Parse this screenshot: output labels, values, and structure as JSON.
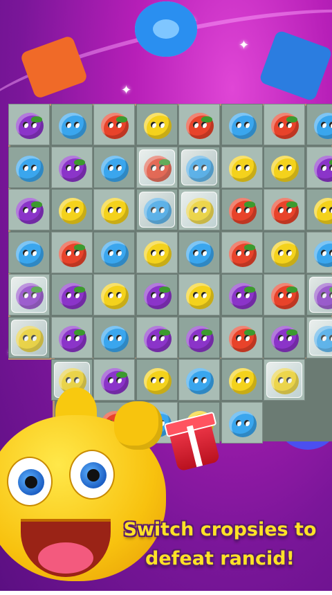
{
  "caption": {
    "line1": "Switch cropsies to",
    "line2": "defeat rancid!"
  },
  "colors": {
    "purple": "#8b34c9",
    "blue": "#3aa6ee",
    "red": "#e8432a",
    "yellow": "#f4d21c",
    "caption_text": "#ffe227"
  },
  "board": {
    "rows": [
      [
        "purple",
        "blue",
        "red",
        "yellow",
        "red",
        "blue",
        "red",
        "blue"
      ],
      [
        "blue",
        "purple",
        "blue",
        "red*",
        "blue*",
        "yellow",
        "yellow",
        "purple"
      ],
      [
        "purple",
        "yellow",
        "yellow",
        "blue*",
        "yellow*",
        "red",
        "red",
        "yellow"
      ],
      [
        "blue",
        "red",
        "blue",
        "yellow",
        "blue",
        "red",
        "yellow",
        "blue"
      ],
      [
        "purple*",
        "purple",
        "yellow",
        "purple",
        "yellow",
        "purple",
        "red",
        "purple*"
      ],
      [
        "yellow*",
        "purple",
        "blue",
        "purple",
        "purple",
        "red",
        "purple",
        "blue*"
      ],
      [
        "",
        "yellow*",
        "purple",
        "yellow",
        "blue",
        "yellow",
        "yellow*",
        ""
      ],
      [
        "",
        "",
        "red",
        "blue",
        "yellow",
        "blue",
        "",
        ""
      ]
    ]
  },
  "icons": [
    "sparkle-icon",
    "donut-candy-icon",
    "gift-box-icon",
    "mascot-icon"
  ]
}
